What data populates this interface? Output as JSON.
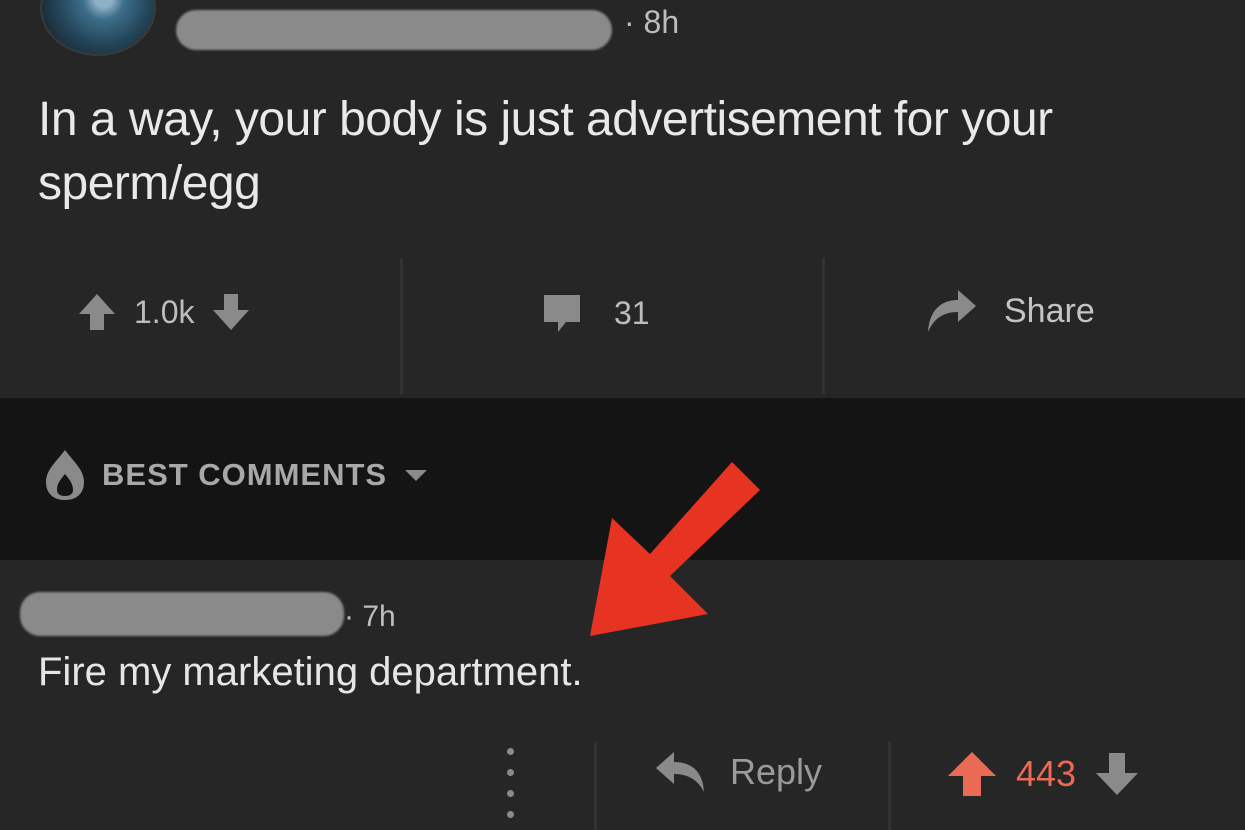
{
  "post": {
    "time": "· 8h",
    "body": "In a way, your body is just advertisement for your sperm/egg",
    "votes": "1.0k",
    "comments": "31",
    "share_label": "Share"
  },
  "sort": {
    "label": "BEST COMMENTS"
  },
  "comment": {
    "time": "· 7h",
    "body": "Fire my marketing department.",
    "reply_label": "Reply",
    "votes": "443"
  },
  "colors": {
    "background": "#262627",
    "band": "#141414",
    "upvoted": "#ea6a55",
    "annotation_arrow": "#e63322"
  },
  "icons": [
    "avatar",
    "upvote-icon",
    "downvote-icon",
    "comment-icon",
    "share-icon",
    "flame-icon",
    "chevron-down-icon",
    "more-icon",
    "reply-icon"
  ]
}
